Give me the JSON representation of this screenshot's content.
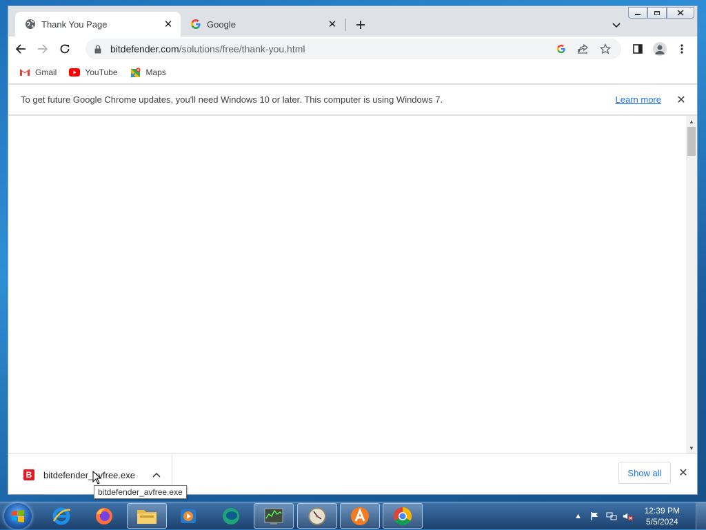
{
  "tabs": [
    {
      "title": "Thank You Page",
      "favicon": "globe-icon",
      "active": true
    },
    {
      "title": "Google",
      "favicon": "google-icon",
      "active": false
    }
  ],
  "window_controls": {
    "minimize": "minimize-icon",
    "maximize": "maximize-icon",
    "close": "close-icon"
  },
  "omnibox": {
    "domain": "bitdefender.com",
    "path": "/solutions/free/thank-you.html"
  },
  "bookmarks": [
    {
      "label": "Gmail",
      "icon": "gmail-icon"
    },
    {
      "label": "YouTube",
      "icon": "youtube-icon"
    },
    {
      "label": "Maps",
      "icon": "maps-icon"
    }
  ],
  "infobar": {
    "message": "To get future Google Chrome updates, you'll need Windows 10 or later. This computer is using Windows 7.",
    "link": "Learn more"
  },
  "download": {
    "filename": "bitdefender_avfree.exe",
    "icon_letter": "B",
    "tooltip": "bitdefender_avfree.exe",
    "show_all": "Show all"
  },
  "taskbar": {
    "apps": [
      "internet-explorer-icon",
      "firefox-icon",
      "file-explorer-icon",
      "media-player-icon",
      "chat-app-icon",
      "task-manager-icon",
      "clock-app-icon",
      "avast-icon",
      "chrome-icon"
    ],
    "time": "12:39 PM",
    "date": "5/5/2024"
  },
  "colors": {
    "accent": "#1a73e8",
    "download_icon": "#e01b22",
    "taskbar": "#23497a"
  }
}
